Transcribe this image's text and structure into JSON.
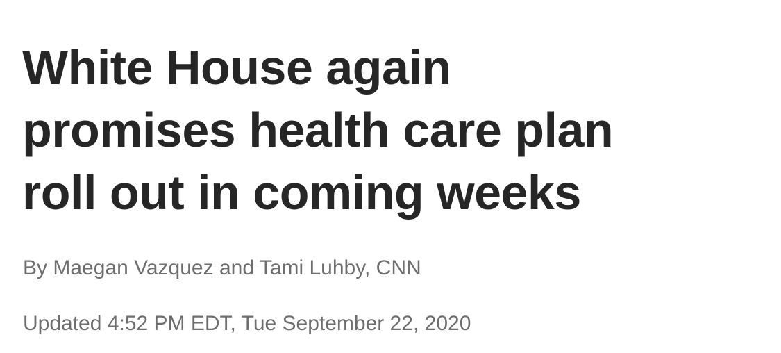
{
  "article": {
    "headline_lines": [
      "White House again",
      "promises health care plan",
      "roll out in coming weeks"
    ],
    "byline": "By Maegan Vazquez and Tami Luhby, CNN",
    "timestamp": "Updated 4:52 PM EDT, Tue September 22, 2020"
  },
  "colors": {
    "headline": "#262626",
    "meta_text": "#6e6e6e",
    "background": "#ffffff"
  }
}
